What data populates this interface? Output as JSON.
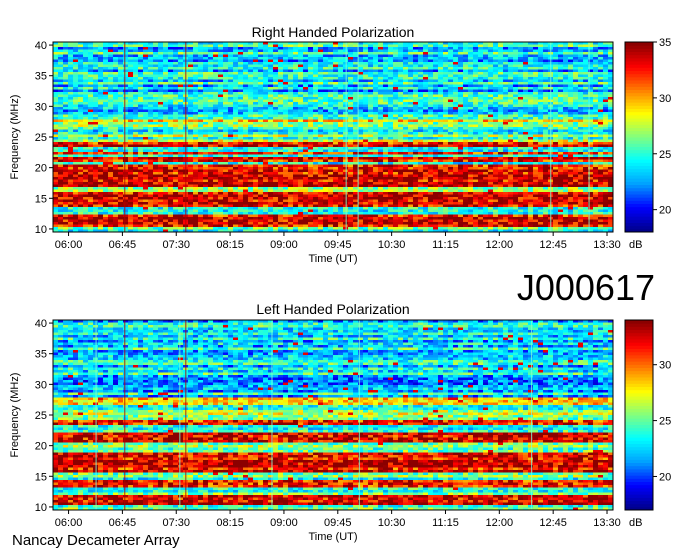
{
  "figure": {
    "id_label": "J000617",
    "footer": "Nancay Decameter Array"
  },
  "chart_data": [
    {
      "type": "heatmap",
      "title": "Right Handed Polarization",
      "xlabel": "Time (UT)",
      "ylabel": "Frequency (MHz)",
      "x_ticks": [
        "06:00",
        "06:45",
        "07:30",
        "08:15",
        "09:00",
        "09:45",
        "10:30",
        "11:15",
        "12:00",
        "12:45",
        "13:30"
      ],
      "y_ticks": [
        10,
        15,
        20,
        25,
        30,
        35,
        40
      ],
      "ylim": [
        9.5,
        40.5
      ],
      "xlim": [
        "05:47",
        "13:35"
      ],
      "colorbar": {
        "ticks": [
          20,
          25,
          30,
          35
        ],
        "range": [
          18,
          35
        ],
        "unit": "dB"
      },
      "colormap": [
        "#00008b",
        "#0000ff",
        "#00a0ff",
        "#00ffff",
        "#80ff80",
        "#ffff00",
        "#ff8000",
        "#ff0000",
        "#8b0000"
      ],
      "bright_bands_mhz": [
        [
          10.5,
          12.5
        ],
        [
          13.5,
          16
        ],
        [
          17,
          20.5
        ],
        [
          21,
          21.6
        ],
        [
          22,
          22.6
        ],
        [
          23.2,
          24
        ]
      ],
      "vertical_lines_ut": [
        "06:47",
        "07:38",
        "09:52",
        "10:02",
        "12:43",
        "13:15"
      ]
    },
    {
      "type": "heatmap",
      "title": "Left Handed Polarization",
      "xlabel": "Time (UT)",
      "ylabel": "Frequency (MHz)",
      "x_ticks": [
        "06:00",
        "06:45",
        "07:30",
        "08:15",
        "09:00",
        "09:45",
        "10:30",
        "11:15",
        "12:00",
        "12:45",
        "13:30"
      ],
      "y_ticks": [
        10,
        15,
        20,
        25,
        30,
        35,
        40
      ],
      "ylim": [
        9.5,
        40.5
      ],
      "xlim": [
        "05:47",
        "13:35"
      ],
      "colorbar": {
        "ticks": [
          20,
          25,
          30
        ],
        "range": [
          17,
          34
        ],
        "unit": "dB"
      },
      "colormap": [
        "#00008b",
        "#0000ff",
        "#00a0ff",
        "#00ffff",
        "#80ff80",
        "#ffff00",
        "#ff8000",
        "#ff0000",
        "#8b0000"
      ],
      "bright_bands_mhz": [
        [
          10.5,
          12
        ],
        [
          13,
          14.5
        ],
        [
          15.5,
          19
        ],
        [
          20.5,
          22
        ],
        [
          23.5,
          24
        ]
      ],
      "vertical_lines_ut": [
        "06:23",
        "06:47",
        "07:33",
        "07:38",
        "08:50",
        "10:03",
        "12:27"
      ]
    }
  ]
}
